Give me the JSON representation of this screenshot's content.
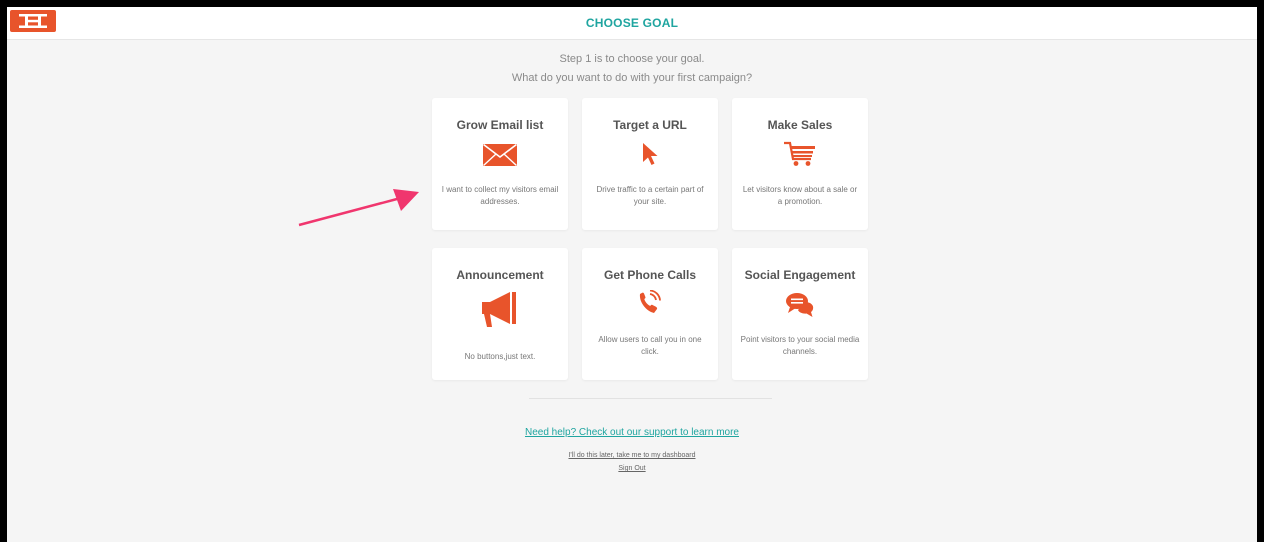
{
  "header": {
    "title": "CHOOSE GOAL"
  },
  "intro": {
    "step": "Step 1 is to choose your goal.",
    "question": "What do you want to do with your first campaign?"
  },
  "goals": [
    {
      "title": "Grow Email list",
      "icon": "envelope-icon",
      "description": "I want to collect my visitors email addresses."
    },
    {
      "title": "Target a URL",
      "icon": "cursor-icon",
      "description": "Drive traffic to a certain part of your site."
    },
    {
      "title": "Make Sales",
      "icon": "cart-icon",
      "description": "Let visitors know about a sale or a promotion."
    },
    {
      "title": "Announcement",
      "icon": "megaphone-icon",
      "description": "No buttons,just text."
    },
    {
      "title": "Get Phone Calls",
      "icon": "phone-icon",
      "description": "Allow users to call you in one click."
    },
    {
      "title": "Social Engagement",
      "icon": "chat-bubbles-icon",
      "description": "Point visitors to your social media channels."
    }
  ],
  "footer": {
    "help": "Need help? Check out our support to learn more",
    "later": "I'll do this later, take me to my dashboard",
    "signout": "Sign Out"
  },
  "colors": {
    "accent": "#e8542b",
    "teal": "#1fa5a0",
    "background": "#f5f5f5",
    "annotation_arrow": "#f0366e"
  }
}
